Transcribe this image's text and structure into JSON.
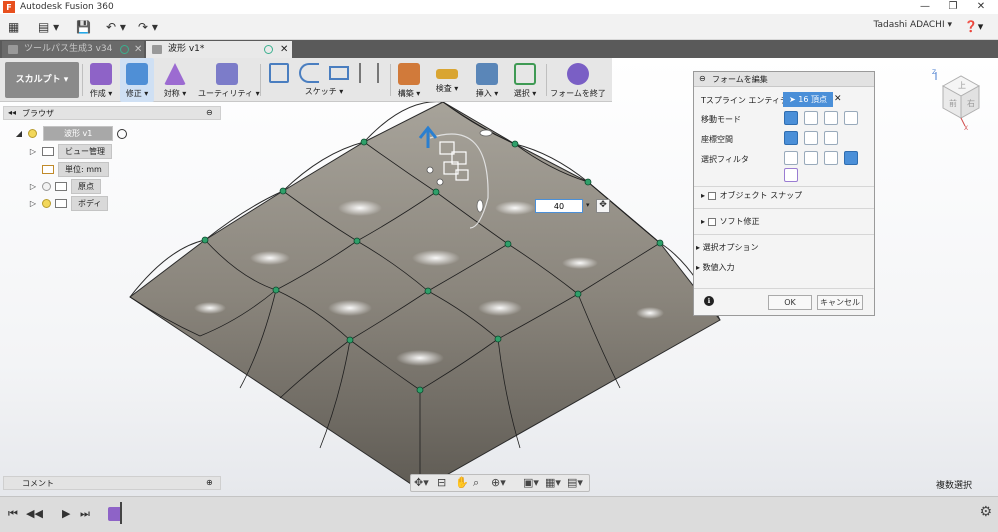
{
  "app": {
    "title": "Autodesk Fusion 360",
    "logo": "F"
  },
  "window_controls": {
    "minimize": "—",
    "restore": "❐",
    "close": "✕"
  },
  "quick_access": {
    "grid_icon": "▦",
    "file_icon": "▤ ▾",
    "save_icon": "💾",
    "undo_icon": "↶ ▾",
    "redo_icon": "↷ ▾",
    "user": "Tadashi ADACHI ▾",
    "help": "❓▾"
  },
  "tabs": [
    {
      "label": "ツールパス生成3 v34",
      "active": false
    },
    {
      "label": "波形 v1*",
      "active": true
    }
  ],
  "toolbar": {
    "workspace": "スカルプト ▾",
    "groups": [
      {
        "label": "作成 ▾",
        "color": "#8e63c7"
      },
      {
        "label": "修正 ▾",
        "color": "#4f8fd6"
      },
      {
        "label": "対称 ▾",
        "color": "#9c6bd1"
      },
      {
        "label": "ユーティリティ ▾",
        "color": "#7c7cc9"
      },
      {
        "label": "スケッチ ▾",
        "color": "#4a7ec0"
      },
      {
        "label": "構築 ▾",
        "color": "#d17a3a"
      },
      {
        "label": "検査 ▾",
        "color": "#d9a532"
      },
      {
        "label": "挿入 ▾",
        "color": "#5a86b8"
      },
      {
        "label": "選択 ▾",
        "color": "#3f9a54"
      },
      {
        "label": "フォームを終了",
        "color": "#7a5fc5"
      }
    ]
  },
  "browser": {
    "title": "ブラウザ",
    "collapse": "◂◂",
    "min": "⊖",
    "root": "波形 v1",
    "items": [
      {
        "label": "ビュー管理"
      },
      {
        "label": "単位: mm"
      },
      {
        "label": "原点"
      },
      {
        "label": "ボディ"
      }
    ]
  },
  "comments": {
    "title": "コメント",
    "add": "⊕"
  },
  "dialog": {
    "title": "フォームを編集",
    "tspline_label": "Tスプライン エンティティ",
    "tspline_value": "16 頂点",
    "clear": "✕",
    "move_mode": "移動モード",
    "coord_space": "座標空間",
    "select_filter": "選択フィルタ",
    "object_snap": "オブジェクト スナップ",
    "soft_modify": "ソフト修正",
    "select_options": "選択オプション",
    "numeric_input": "数値入力",
    "info": "ℹ",
    "ok": "OK",
    "cancel": "キャンセル"
  },
  "numeric_field": {
    "value": "40"
  },
  "status": {
    "multi_select": "複数選択"
  },
  "navbar": {
    "orbit": "✥▾",
    "look": "⊟",
    "pan": "✋",
    "zoom": "⌕",
    "fit": "⊕▾",
    "display": "▣▾",
    "grid": "▦▾",
    "viewports": "▤▾"
  },
  "viewcube": {
    "front": "前",
    "right": "右",
    "top": "上"
  },
  "timeline": {
    "first": "⏮",
    "prev": "◀◀",
    "play": "▶",
    "next": "▶▶",
    "last": "⏭",
    "gear": "⚙"
  },
  "colors": {
    "surface": "#8d887f",
    "accent": "#4a8fd8",
    "vertex": "#2fa06a"
  }
}
